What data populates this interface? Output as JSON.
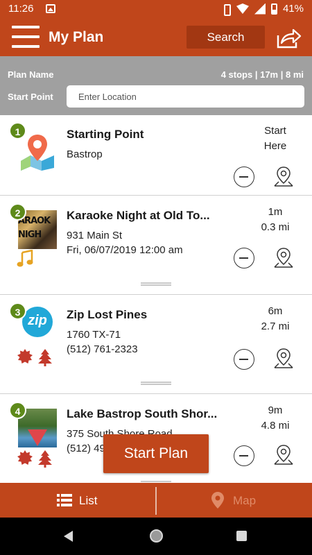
{
  "status_bar": {
    "time": "11:26",
    "battery": "41%"
  },
  "header": {
    "title": "My Plan",
    "search_label": "Search"
  },
  "plan": {
    "name_label": "Plan Name",
    "stats": "4 stops | 17m | 8 mi",
    "start_point_label": "Start Point",
    "start_point_placeholder": "Enter Location"
  },
  "stops": [
    {
      "number": "1",
      "title": "Starting Point",
      "line1": "Bastrop",
      "line2": "",
      "metric_top": "Start",
      "metric_bottom": "Here"
    },
    {
      "number": "2",
      "title": "Karaoke Night at Old To...",
      "line1": "931 Main St",
      "line2": "Fri, 06/07/2019 12:00 am",
      "metric_top": "1m",
      "metric_bottom": "0.3 mi",
      "thumb_text": "ARAOK NIGH"
    },
    {
      "number": "3",
      "title": "Zip Lost Pines",
      "line1": "1760 TX-71",
      "line2": "(512) 761-2323",
      "metric_top": "6m",
      "metric_bottom": "2.7 mi",
      "thumb_text": "zip"
    },
    {
      "number": "4",
      "title": "Lake Bastrop South Shor...",
      "line1": "375 South Shore Road",
      "line2": "(512) 49",
      "metric_top": "9m",
      "metric_bottom": "4.8 mi"
    }
  ],
  "start_plan_label": "Start Plan",
  "tabs": {
    "list_label": "List",
    "map_label": "Map"
  },
  "colors": {
    "brand": "#c0461b",
    "badge": "#5e8a1a",
    "category": "#c33a2c"
  }
}
